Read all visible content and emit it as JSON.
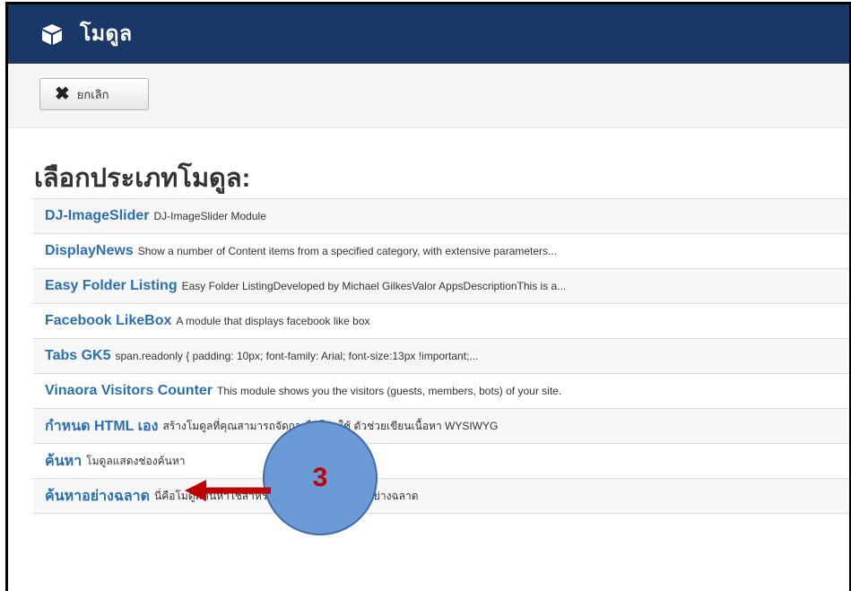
{
  "header": {
    "title": "โมดูล",
    "icon": "cube-icon"
  },
  "toolbar": {
    "cancel_label": "ยกเลิก"
  },
  "page": {
    "heading": "เลือกประเภทโมดูล:"
  },
  "modules": [
    {
      "name": "DJ-ImageSlider",
      "description": "DJ-ImageSlider Module"
    },
    {
      "name": "DisplayNews",
      "description": "Show a number of Content items from a specified category, with extensive parameters..."
    },
    {
      "name": "Easy Folder Listing",
      "description": "Easy Folder ListingDeveloped by Michael GilkesValor AppsDescriptionThis is a..."
    },
    {
      "name": "Facebook LikeBox",
      "description": "A module that displays facebook like box"
    },
    {
      "name": "Tabs GK5",
      "description": "span.readonly { padding: 10px; font-family: Arial; font-size:13px !important;..."
    },
    {
      "name": "Vinaora Visitors Counter",
      "description": "This module shows you the visitors (guests, members, bots) of your site."
    },
    {
      "name": "กำหนด HTML เอง",
      "description": "สร้างโมดูลที่คุณสามารถจัดการได้โดยใช้ ตัวช่วยเขียนเนื้อหา WYSIWYG"
    },
    {
      "name": "ค้นหา",
      "description": "โมดูลแสดงช่องค้นหา"
    },
    {
      "name": "ค้นหาอย่างฉลาด",
      "description": "นี่คือโมดูลค้นหาใช้สำหรับค้นหาข้อมูลในระบบอย่างฉลาด"
    }
  ],
  "annotation": {
    "number": "3"
  },
  "colors": {
    "header_bg": "#1a3867",
    "link": "#2a6fb4",
    "annotation_bubble": "#6b9ad6",
    "annotation_text": "#c00000",
    "annotation_arrow": "#c00000"
  }
}
